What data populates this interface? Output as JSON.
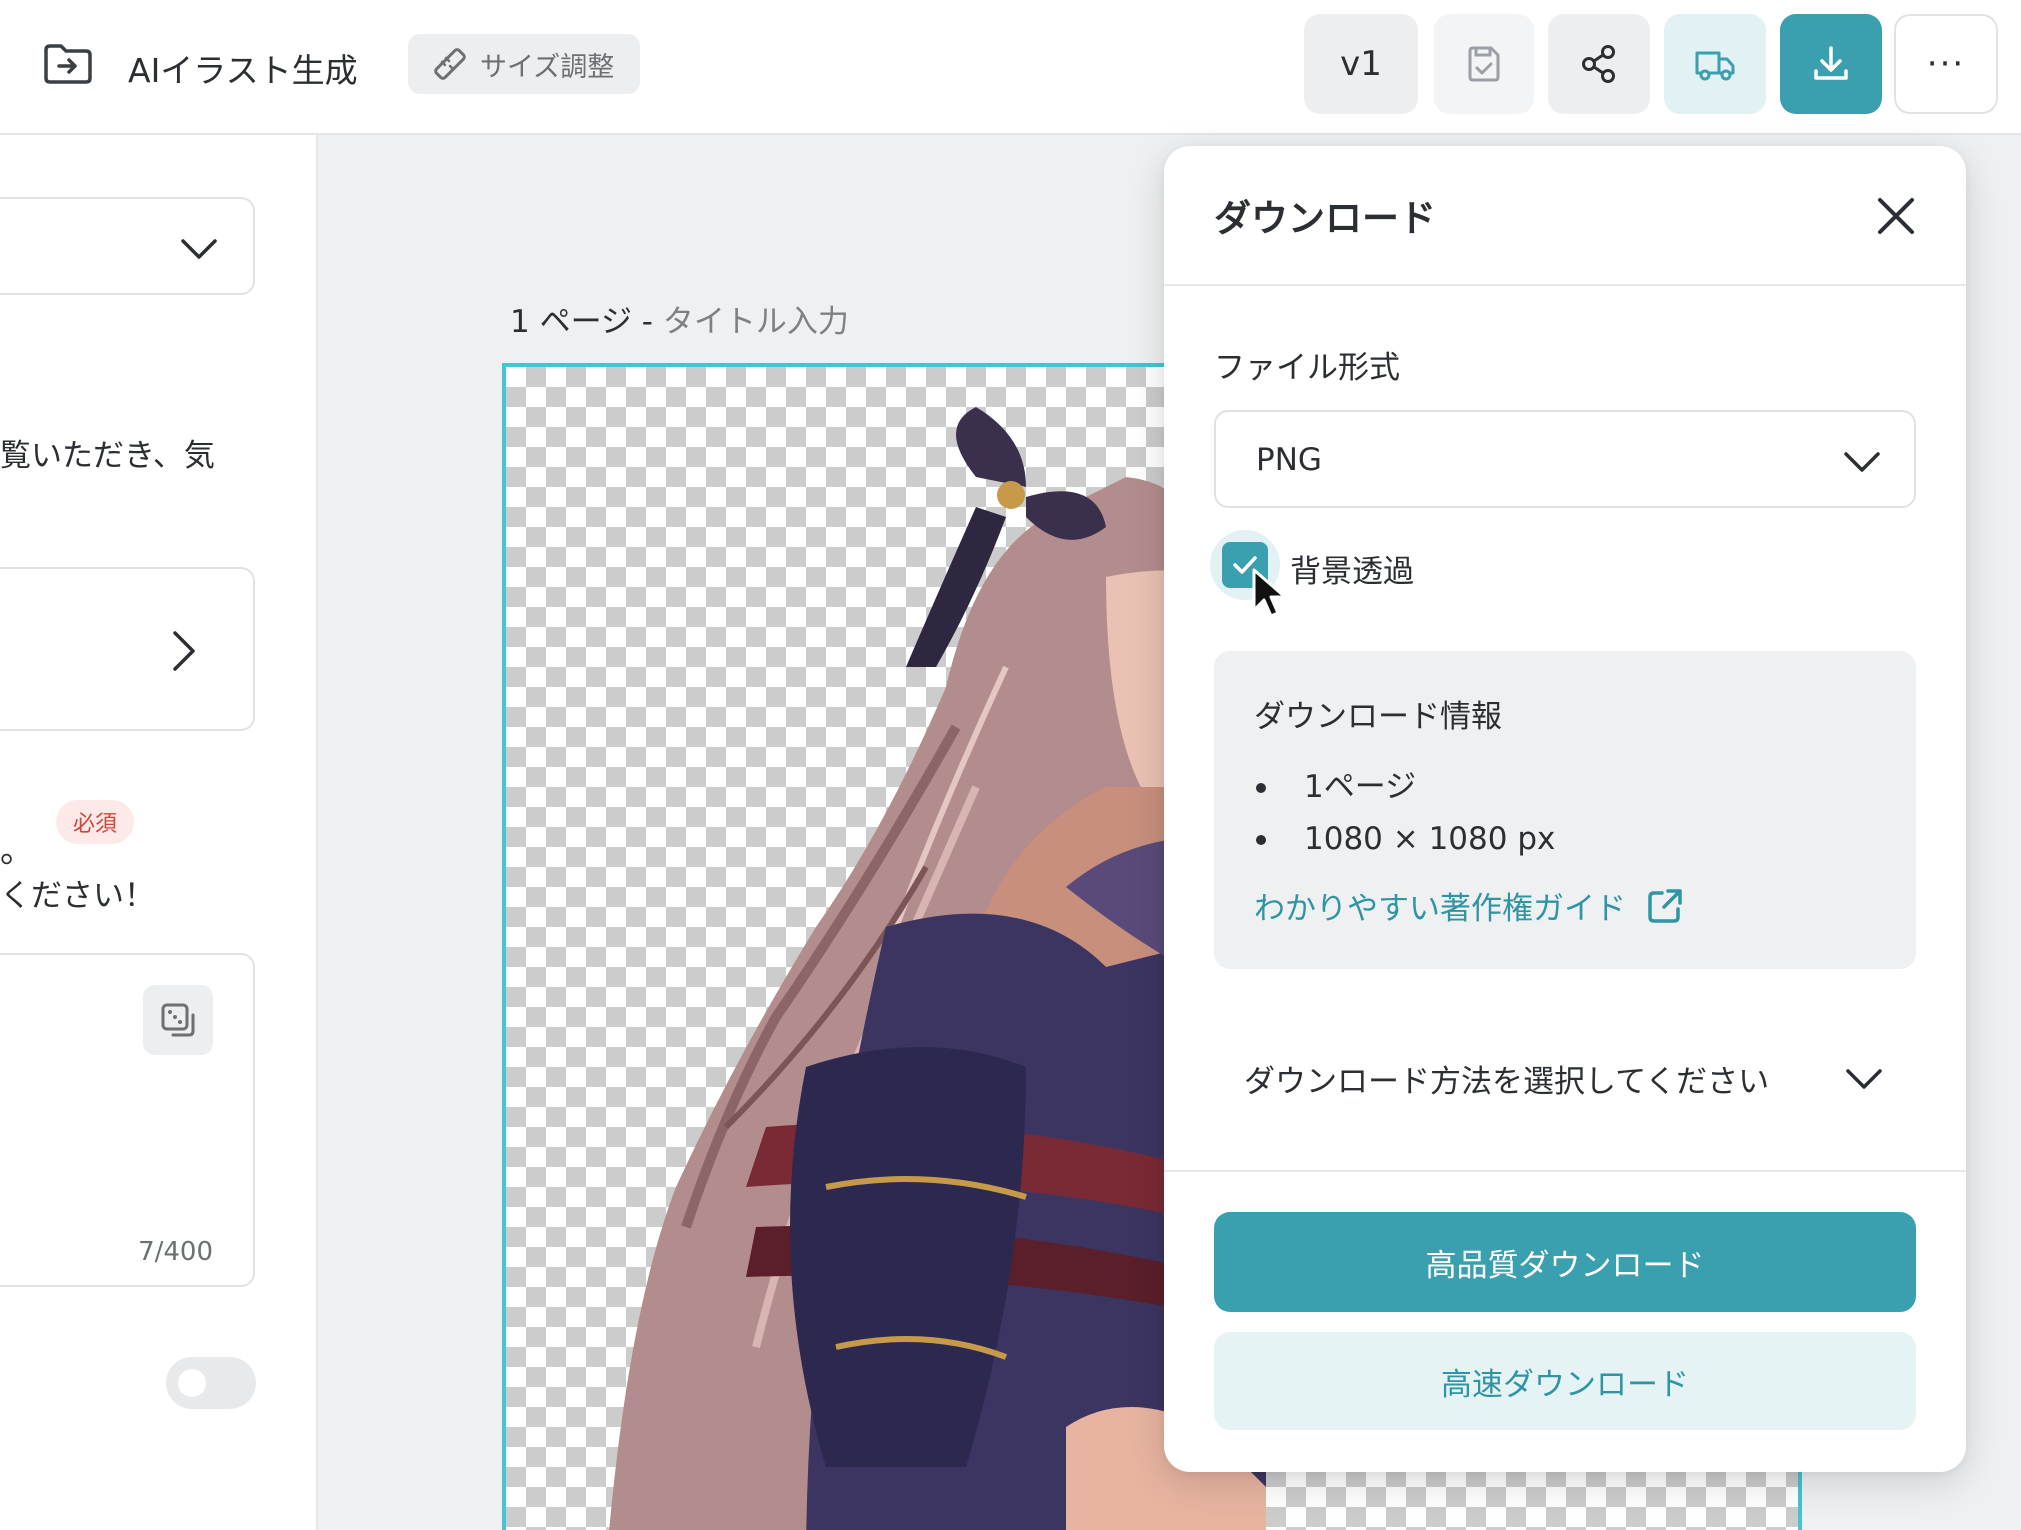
{
  "header": {
    "app_title": "AIイラスト生成",
    "size_chip_label": "サイズ調整",
    "version_label": "v1",
    "more_label": "···"
  },
  "left_panel": {
    "text_line1": "覧いただき、気",
    "dot": "。",
    "required_badge": "必須",
    "text_line2": "ください！",
    "char_count": "7/400"
  },
  "canvas": {
    "page_number": "1 ページ - ",
    "page_title_placeholder": "タイトル入力"
  },
  "download_panel": {
    "title": "ダウンロード",
    "file_format_label": "ファイル形式",
    "file_format_value": "PNG",
    "transparent_bg_label": "背景透過",
    "transparent_bg_checked": true,
    "info_title": "ダウンロード情報",
    "info_items": [
      "1ページ",
      "1080 × 1080 px"
    ],
    "copyright_guide_link": "わかりやすい著作権ガイド",
    "method_placeholder": "ダウンロード方法を選択してください",
    "high_quality_button": "高品質ダウンロード",
    "fast_button": "高速ダウンロード"
  },
  "colors": {
    "accent": "#3a9fae",
    "accent_light": "#e6f3f5",
    "required_red": "#d0453a",
    "artboard_border": "#45c4d3"
  },
  "icons": {
    "header": [
      "folder-export-icon",
      "ruler-icon",
      "save-check-icon",
      "share-icon",
      "truck-icon",
      "download-icon"
    ],
    "panel": [
      "close-icon",
      "chevron-down-icon",
      "check-icon",
      "external-link-icon",
      "cursor-icon"
    ],
    "left": [
      "chevron-down-icon",
      "chevron-right-icon",
      "dice-icon"
    ]
  }
}
